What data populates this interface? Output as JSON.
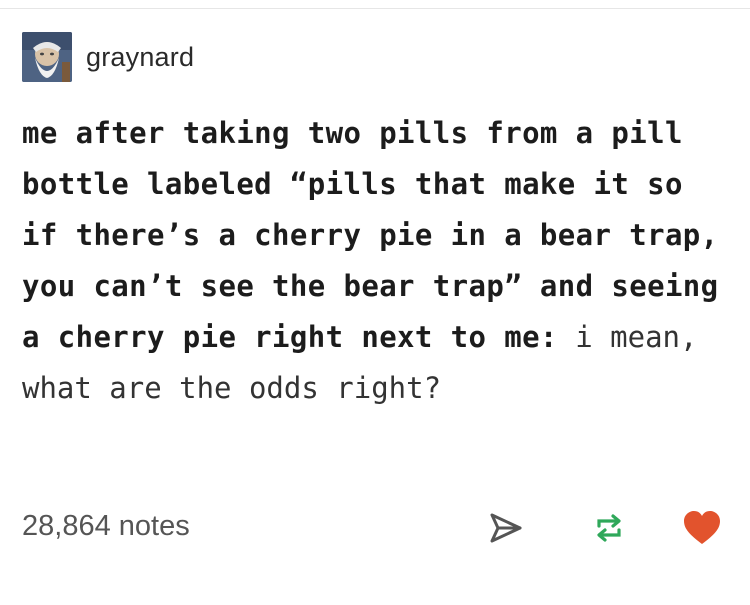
{
  "post": {
    "username": "graynard",
    "body_bold": "me after taking two pills from a pill bottle labeled “pills that make it so if there’s a cherry pie in a bear trap, you can’t see the bear trap” and seeing a cherry pie right next to me:",
    "body_reply": " i mean, what are the odds right?",
    "notes": "28,864 notes"
  },
  "icons": {
    "avatar": "avatar-wizard",
    "share": "share-icon",
    "reblog": "reblog-icon",
    "like": "heart-icon"
  },
  "colors": {
    "reblog": "#2fa85a",
    "like": "#e2532d",
    "text": "#1c1c1c",
    "notes": "#555555"
  }
}
